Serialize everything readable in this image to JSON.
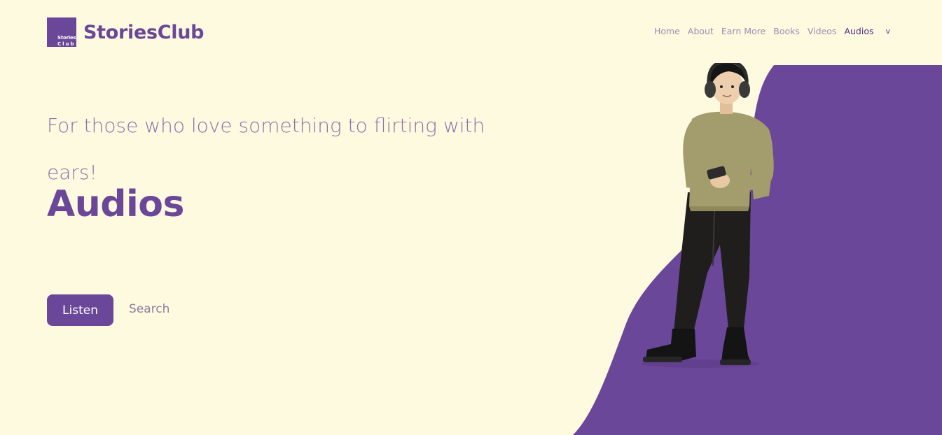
{
  "brand": {
    "logo_line1": "Stories",
    "logo_line2": "Club",
    "name": "StoriesClub"
  },
  "nav": {
    "items": [
      {
        "label": "Home"
      },
      {
        "label": "About"
      },
      {
        "label": "Earn More"
      },
      {
        "label": "Books"
      },
      {
        "label": "Videos"
      },
      {
        "label": "Audios"
      }
    ],
    "active": "Audios",
    "more_label": "v"
  },
  "hero": {
    "tagline": "For those who love something to flirting with ears!",
    "title": "Audios",
    "primary_button": "Listen",
    "secondary_button": "Search"
  },
  "colors": {
    "background": "#fdfadf",
    "accent": "#6b4799",
    "nav_text": "#9b8fb1",
    "tagline": "#8a72ad"
  },
  "icons": {
    "logo": "storiesclub-logo",
    "illustration": "person-with-headphones-illustration"
  }
}
